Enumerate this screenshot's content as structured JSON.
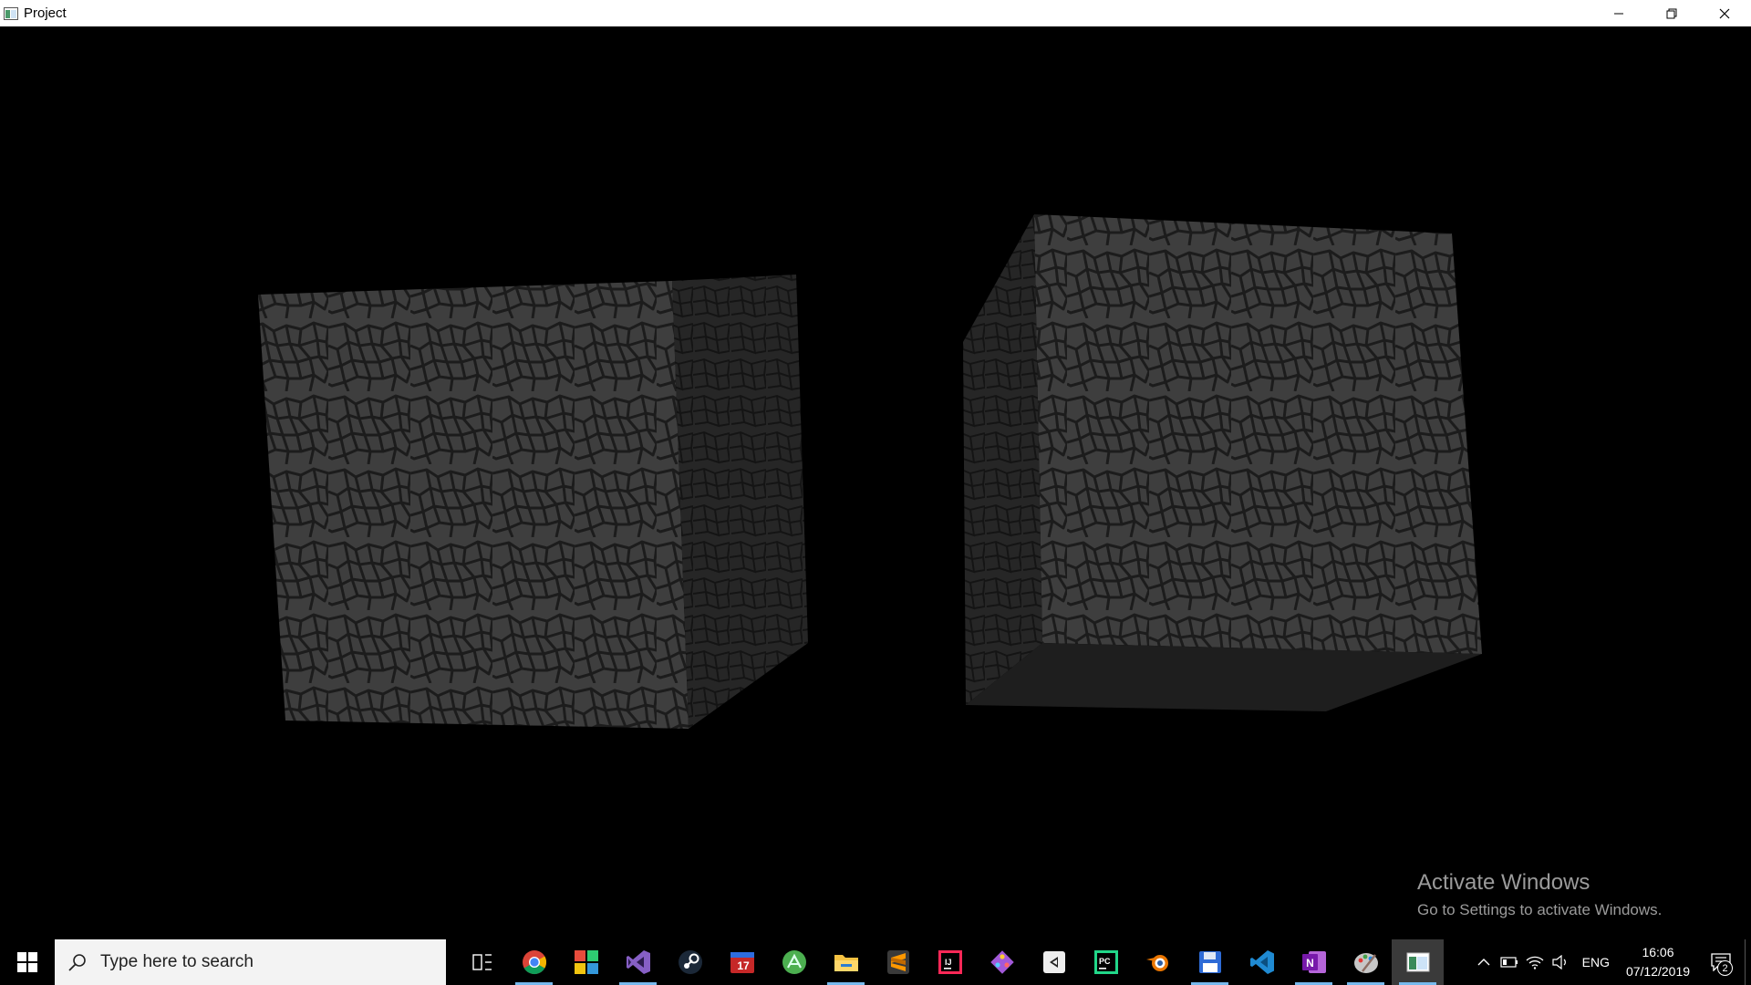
{
  "window": {
    "title": "Project"
  },
  "watermark": {
    "title": "Activate Windows",
    "subtitle": "Go to Settings to activate Windows."
  },
  "taskbar": {
    "search_placeholder": "Type here to search",
    "apps": [
      {
        "name": "task-view-icon",
        "running": false
      },
      {
        "name": "chrome-icon",
        "running": true
      },
      {
        "name": "color-grid-app-icon",
        "running": false
      },
      {
        "name": "visual-studio-icon",
        "running": true
      },
      {
        "name": "steam-icon",
        "running": false
      },
      {
        "name": "calendar-app-icon",
        "running": false
      },
      {
        "name": "android-studio-icon",
        "running": false
      },
      {
        "name": "file-explorer-icon",
        "running": true
      },
      {
        "name": "sublime-text-icon",
        "running": false
      },
      {
        "name": "intellij-icon",
        "running": false
      },
      {
        "name": "git-app-icon",
        "running": false
      },
      {
        "name": "unity-icon",
        "running": false
      },
      {
        "name": "pycharm-icon",
        "running": false
      },
      {
        "name": "blender-icon",
        "running": false
      },
      {
        "name": "save-disk-icon",
        "running": true
      },
      {
        "name": "vscode-icon",
        "running": false
      },
      {
        "name": "onenote-icon",
        "running": true
      },
      {
        "name": "paint-icon",
        "running": true
      },
      {
        "name": "project-window-icon",
        "running": true
      }
    ],
    "tray": {
      "language": "ENG",
      "time": "16:06",
      "date": "07/12/2019",
      "notification_count": "2"
    }
  },
  "colors": {
    "taskbar_bg": "#000000",
    "accent_running": "#76b9ed",
    "viewport_bg": "#000000",
    "stone_face": "#3c3c3c"
  }
}
